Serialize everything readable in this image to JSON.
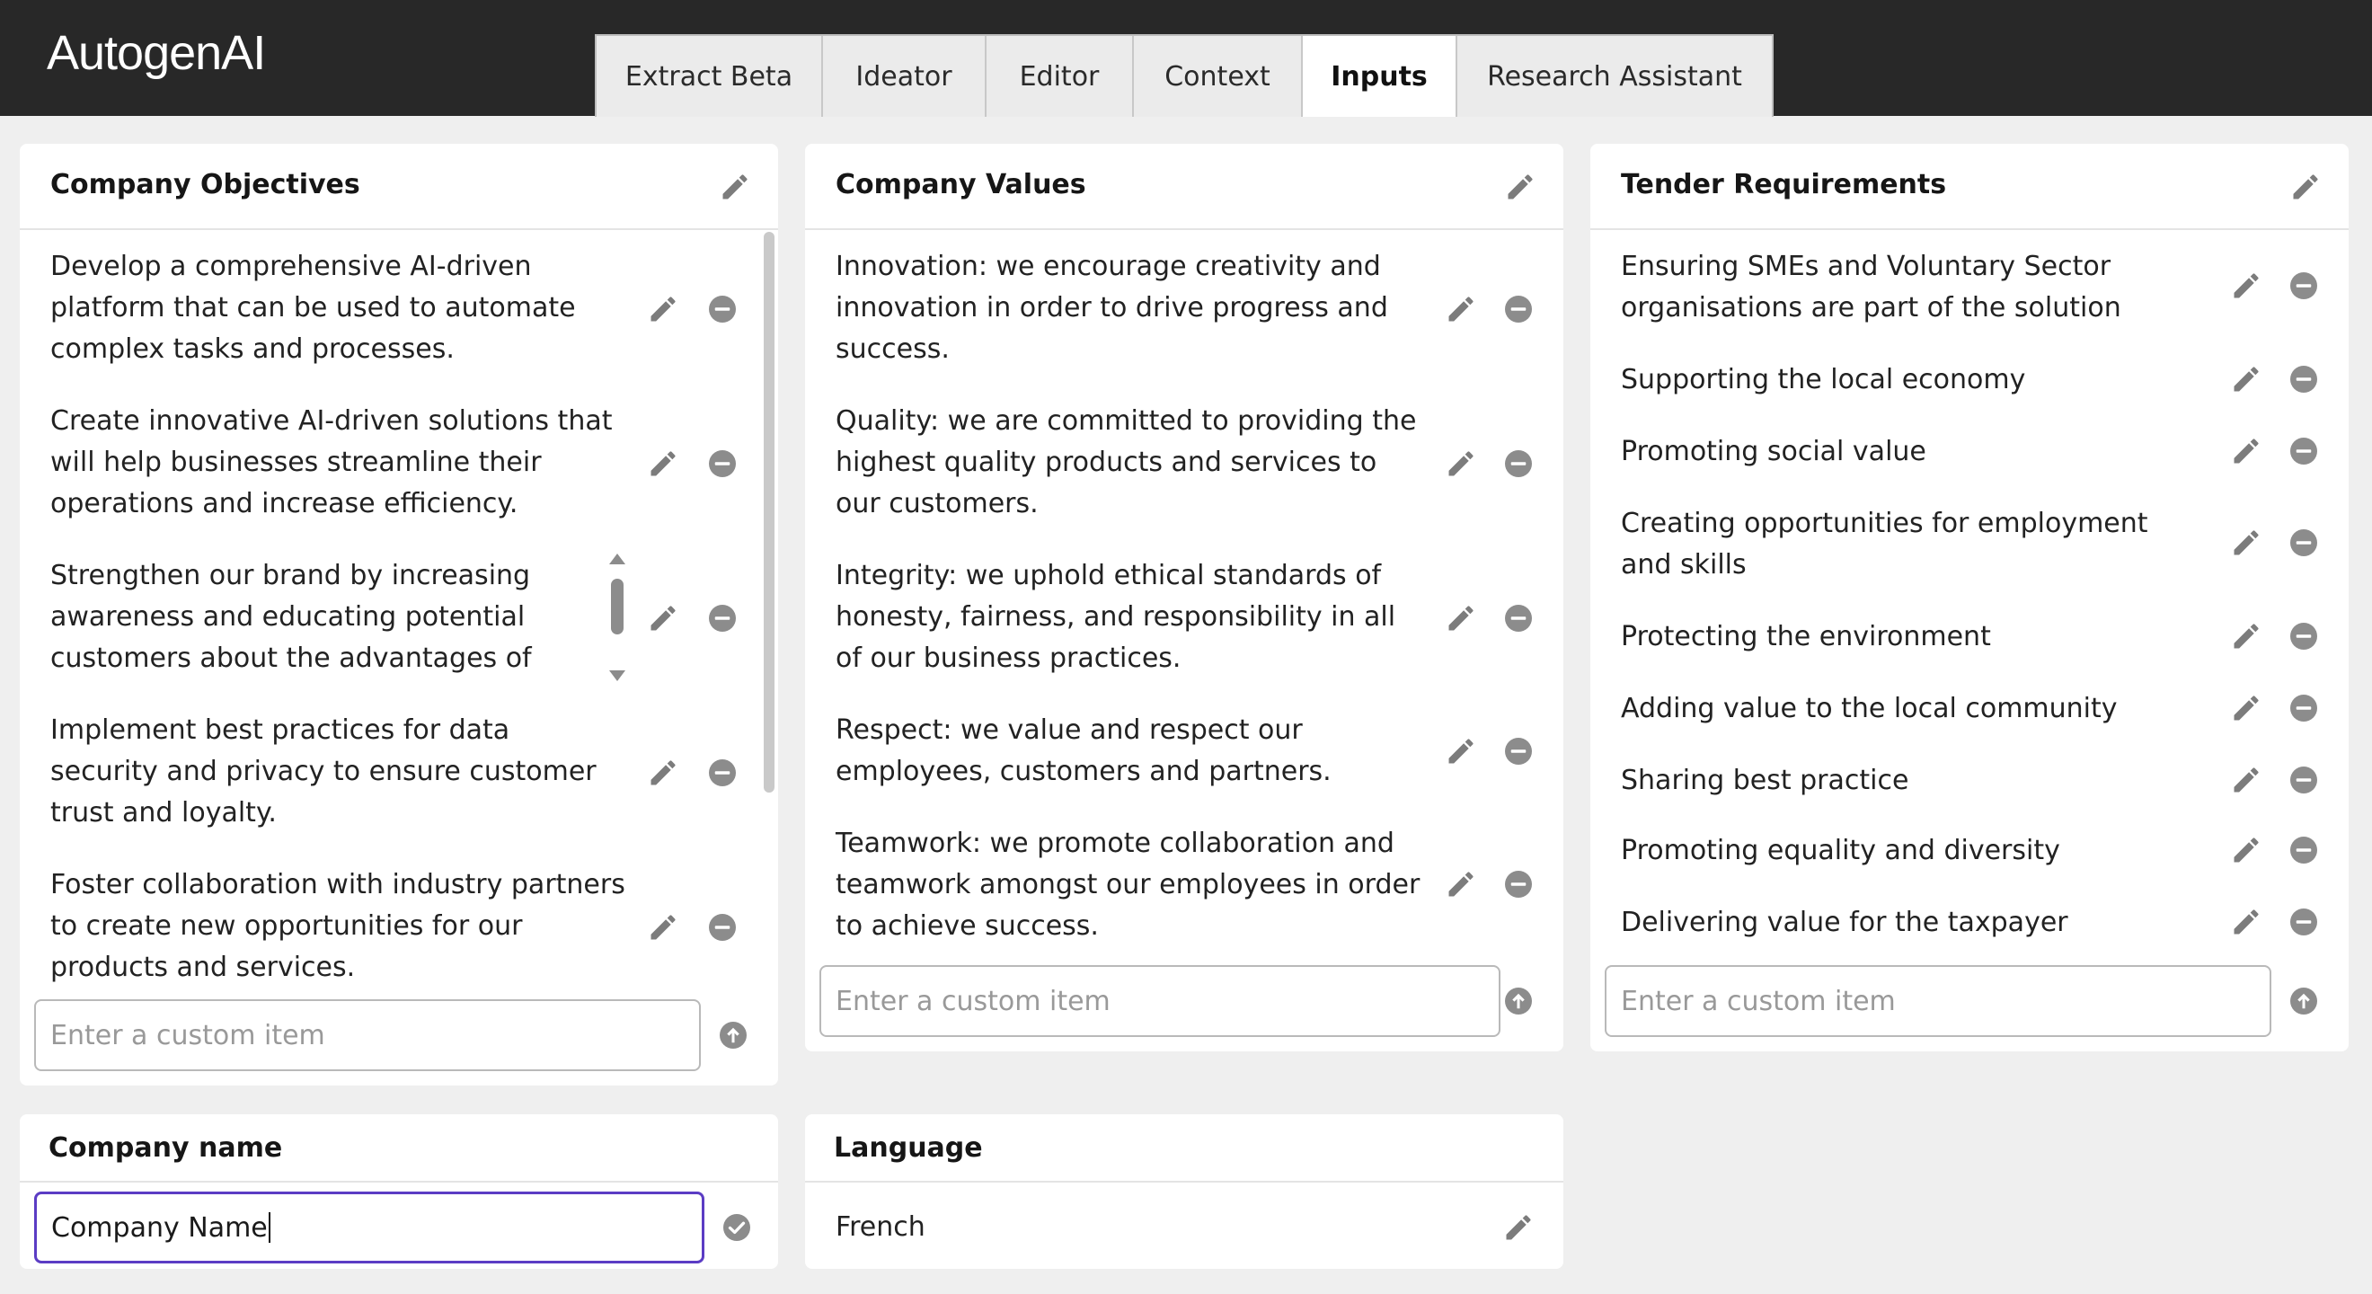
{
  "app": {
    "logo": "AutogenAI"
  },
  "tabs": [
    {
      "label": "Extract Beta"
    },
    {
      "label": "Ideator"
    },
    {
      "label": "Editor"
    },
    {
      "label": "Context"
    },
    {
      "label": "Inputs",
      "active": true
    },
    {
      "label": "Research Assistant"
    }
  ],
  "company_objectives": {
    "title": "Company Objectives",
    "items": [
      "Develop a comprehensive AI-driven platform that can be used to automate complex tasks and processes.",
      "Create innovative AI-driven solutions that will help businesses streamline their operations and increase efficiency.",
      "Strengthen our brand by increasing awareness and educating potential customers about the advantages of our",
      "Implement best practices for data security and privacy to ensure customer trust and loyalty.",
      "Foster collaboration with industry partners to create new opportunities for our products and services."
    ],
    "input_placeholder": "Enter a custom item"
  },
  "company_values": {
    "title": "Company Values",
    "items": [
      "Innovation: we encourage creativity and innovation in order to drive progress and success.",
      "Quality: we are committed to providing the highest quality products and services to our customers.",
      "Integrity: we uphold ethical standards of honesty, fairness, and responsibility in all of our business practices.",
      "Respect: we value and respect our employees, customers and partners.",
      "Teamwork: we promote collaboration and teamwork amongst our employees in order to achieve success."
    ],
    "input_placeholder": "Enter a custom item"
  },
  "tender_requirements": {
    "title": "Tender Requirements",
    "items": [
      "Ensuring SMEs and Voluntary Sector organisations are part of the solution",
      "Supporting the local economy",
      "Promoting social value",
      "Creating opportunities for employment and skills",
      "Protecting the environment",
      "Adding value to the local community",
      "Sharing best practice",
      "Promoting equality and diversity",
      "Delivering value for the taxpayer"
    ],
    "input_placeholder": "Enter a custom item"
  },
  "company_name": {
    "title": "Company name",
    "value": "Company Name"
  },
  "language": {
    "title": "Language",
    "value": "French"
  },
  "icons": {
    "edit": "pencil-icon",
    "remove": "minus-circle-icon",
    "submit": "arrow-up-circle-icon",
    "confirm": "check-circle-icon"
  },
  "colors": {
    "topbar": "#282828",
    "focus_border": "#5b3cc4",
    "icon_gray": "#8c8c8c"
  }
}
